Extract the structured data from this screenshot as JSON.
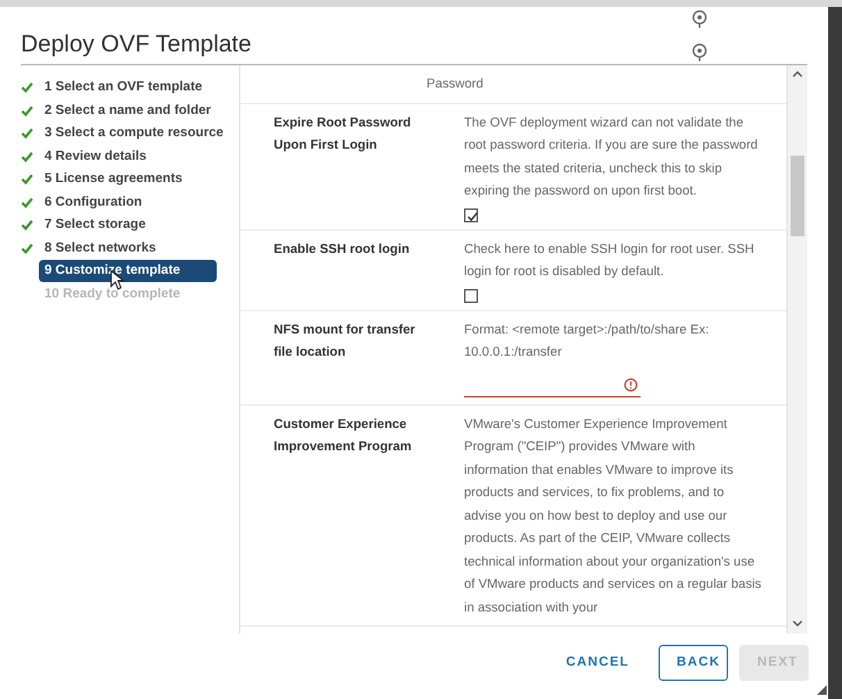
{
  "dialog": {
    "title": "Deploy OVF Template"
  },
  "steps": [
    {
      "label": "1 Select an OVF template",
      "completed": true,
      "selected": false,
      "disabled": false
    },
    {
      "label": "2 Select a name and folder",
      "completed": true,
      "selected": false,
      "disabled": false
    },
    {
      "label": "3 Select a compute resource",
      "completed": true,
      "selected": false,
      "disabled": false
    },
    {
      "label": "4 Review details",
      "completed": true,
      "selected": false,
      "disabled": false
    },
    {
      "label": "5 License agreements",
      "completed": true,
      "selected": false,
      "disabled": false
    },
    {
      "label": "6 Configuration",
      "completed": true,
      "selected": false,
      "disabled": false
    },
    {
      "label": "7 Select storage",
      "completed": true,
      "selected": false,
      "disabled": false
    },
    {
      "label": "8 Select networks",
      "completed": true,
      "selected": false,
      "disabled": false
    },
    {
      "label": "9 Customize template",
      "completed": false,
      "selected": true,
      "disabled": false
    },
    {
      "label": "10 Ready to complete",
      "completed": false,
      "selected": false,
      "disabled": true
    }
  ],
  "properties": [
    {
      "kind": "note",
      "description": "Password"
    },
    {
      "kind": "checkbox",
      "label": "Expire Root Password Upon First Login",
      "description": "The OVF deployment wizard can not validate the root password criteria. If you are sure the password meets the stated criteria, uncheck this to skip expiring the password on upon first boot.",
      "checked": true
    },
    {
      "kind": "checkbox",
      "label": "Enable SSH root login",
      "description": "Check here to enable SSH login for root user. SSH login for root is disabled by default.",
      "checked": false
    },
    {
      "kind": "text",
      "label": "NFS mount for transfer file location",
      "description": "Format: <remote target>:/path/to/share Ex: 10.0.0.1:/transfer",
      "invalid": true
    },
    {
      "kind": "note",
      "label": "Customer Experience Improvement Program",
      "description": "VMware's Customer Experience Improvement Program (\"CEIP\") provides VMware with information that enables VMware to improve its products and services, to fix problems, and to advise you on how best to deploy and use our products. As part of the CEIP, VMware collects technical information about your organization's use of VMware products and services on a regular basis in association with your"
    }
  ],
  "buttons": [
    {
      "kind": "link",
      "label": "CANCEL"
    },
    {
      "kind": "outline",
      "label": "BACK"
    },
    {
      "kind": "disabled",
      "label": "NEXT"
    }
  ]
}
